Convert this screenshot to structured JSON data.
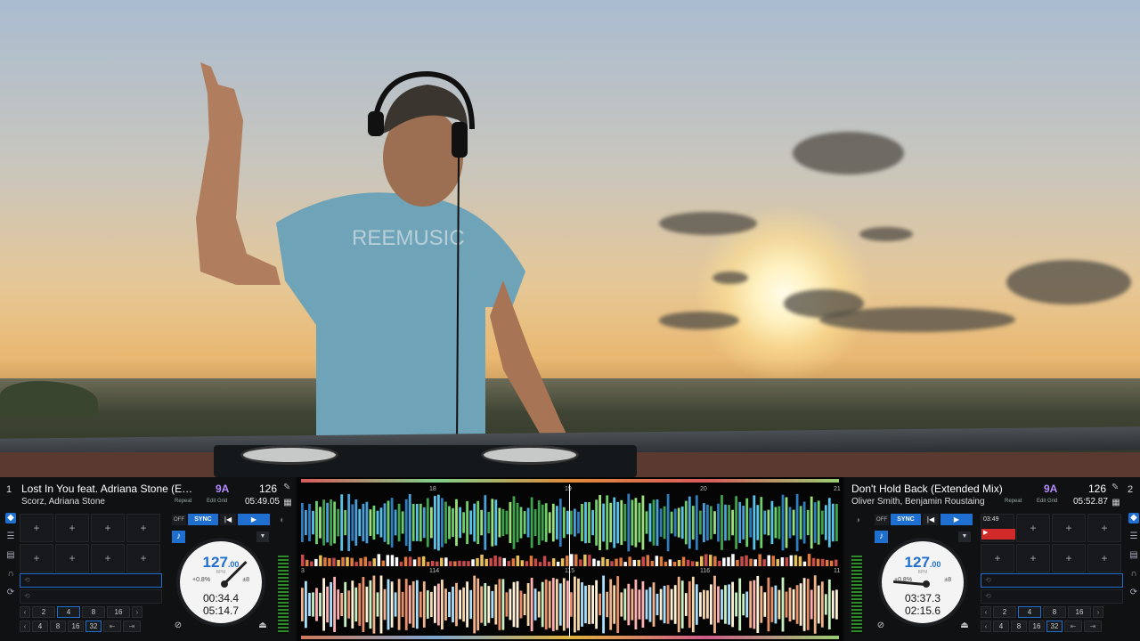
{
  "deck_left": {
    "number": "1",
    "title": "Lost In You feat. Adriana Stone (E…",
    "artist": "Scorz, Adriana Stone",
    "key": "9A",
    "bpm": "126",
    "repeat": "Repeat",
    "edit_grid": "Edit Grid",
    "remaining": "05:49.05",
    "off": "OFF",
    "sync": "SYNC",
    "cue": "|◀",
    "play": "▶",
    "platter_bpm": "127",
    "platter_bpm_dec": ".00",
    "pitch": "+0.8%",
    "range": "±8",
    "elapsed": "00:34.4",
    "time_remaining": "05:14.7",
    "beats_top": [
      "2",
      "4",
      "8",
      "16"
    ],
    "beats_bottom": [
      "4",
      "8",
      "16",
      "32"
    ],
    "selected_top": "4",
    "selected_bottom": "32",
    "pad_symbol": "+",
    "pitch_fill": 0.42
  },
  "deck_right": {
    "number": "2",
    "title": "Don't Hold Back (Extended Mix)",
    "artist": "Oliver Smith, Benjamin Roustaing",
    "key": "9A",
    "bpm": "126",
    "repeat": "Repeat",
    "edit_grid": "Edit Grid",
    "remaining": "05:52.87",
    "off": "OFF",
    "sync": "SYNC",
    "cue": "|◀",
    "play": "▶",
    "platter_bpm": "127",
    "platter_bpm_dec": ".00",
    "pitch": "+0.8%",
    "range": "±8",
    "elapsed": "03:37.3",
    "time_remaining": "02:15.6",
    "cue_time": "03:49",
    "beats_top": [
      "2",
      "4",
      "8",
      "16"
    ],
    "beats_bottom": [
      "4",
      "8",
      "16",
      "32"
    ],
    "selected_top": "4",
    "selected_bottom": "32",
    "pad_symbol": "+",
    "pitch_fill": 0.62
  },
  "waveform": {
    "top_ruler": [
      "18",
      "19",
      "20",
      "21"
    ],
    "top_ruler_left": "",
    "bottom_ruler": [
      "3",
      "114",
      "115",
      "116",
      "11"
    ]
  },
  "scene": {
    "shirt_text": "REEMUSIC"
  },
  "colors": {
    "accent": "#1f6fd1",
    "key": "#b58cff",
    "cue_red": "#d02a2a"
  }
}
